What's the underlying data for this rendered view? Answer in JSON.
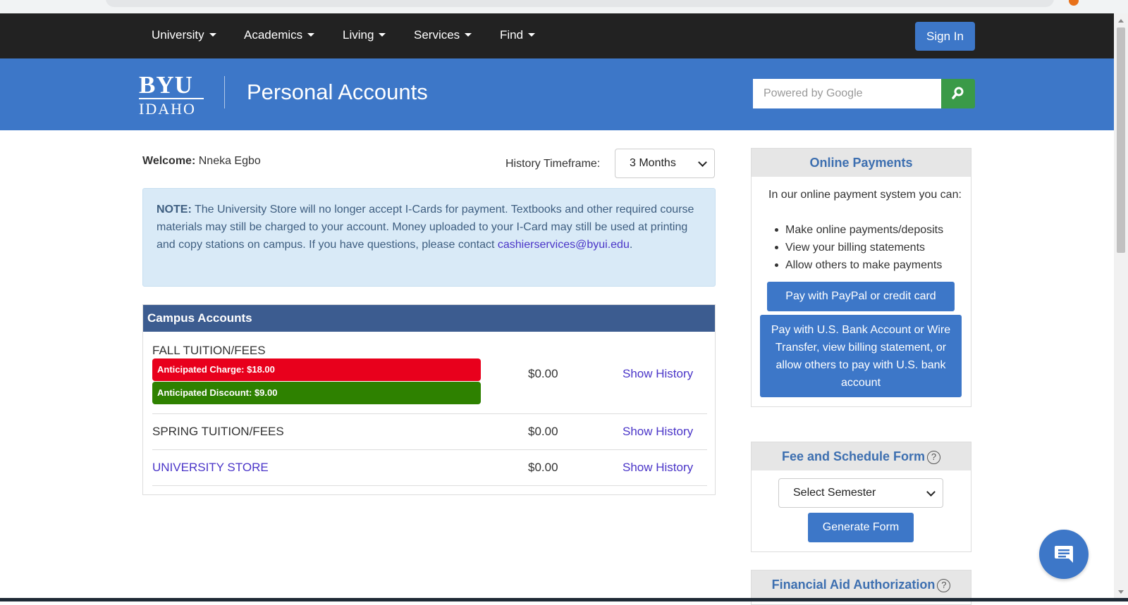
{
  "colors": {
    "nav_bg": "#222222",
    "brand_blue": "#3d77c8",
    "account_header": "#3c5c90",
    "charge_red": "#e8001c",
    "discount_green": "#2e8100",
    "search_green": "#3a9a48",
    "link_purple": "#4a35c8",
    "note_bg": "#d9eaf7"
  },
  "nav": {
    "items": [
      {
        "label": "University"
      },
      {
        "label": "Academics"
      },
      {
        "label": "Living"
      },
      {
        "label": "Services"
      },
      {
        "label": "Find"
      }
    ],
    "signin_label": "Sign In"
  },
  "banner": {
    "logo_top": "BYU",
    "logo_bottom": "IDAHO",
    "title": "Personal Accounts",
    "search_placeholder": "Powered by Google",
    "search_icon": "search-icon"
  },
  "main": {
    "welcome_label": "Welcome:",
    "welcome_name": "Nneka Egbo",
    "timeframe_label": "History Timeframe:",
    "timeframe_value": "3 Months",
    "note": {
      "label": "NOTE:",
      "text": "The University Store will no longer accept I-Cards for payment. Textbooks and other required course materials may still be charged to your account. Money uploaded to your I-Card may still be used at printing and copy stations on campus. If you have questions, please contact",
      "email": "cashierservices@byui.edu",
      "end": "."
    },
    "accounts": {
      "header": "Campus Accounts",
      "rows": [
        {
          "name": "FALL TUITION/FEES",
          "amount": "$0.00",
          "history": "Show History",
          "charge": "Anticipated Charge: $18.00",
          "discount": "Anticipated Discount: $9.00"
        },
        {
          "name": "SPRING TUITION/FEES",
          "amount": "$0.00",
          "history": "Show History"
        },
        {
          "name": "UNIVERSITY STORE",
          "amount": "$0.00",
          "history": "Show History"
        }
      ]
    }
  },
  "sidebar": {
    "online_payments": {
      "title": "Online Payments",
      "intro": "In our online payment system you can:",
      "items": [
        "Make online payments/deposits",
        "View your billing statements",
        "Allow others to make payments"
      ],
      "paypal_button": "Pay with PayPal or credit card",
      "bank_button": "Pay with U.S. Bank Account or Wire Transfer, view billing statement, or allow others to pay with U.S. bank account"
    },
    "fee_form": {
      "title": "Fee and Schedule Form",
      "select_value": "Select Semester",
      "generate_button": "Generate Form"
    },
    "financial_aid": {
      "title": "Financial Aid Authorization"
    }
  },
  "chat": {
    "icon": "chat-icon"
  }
}
